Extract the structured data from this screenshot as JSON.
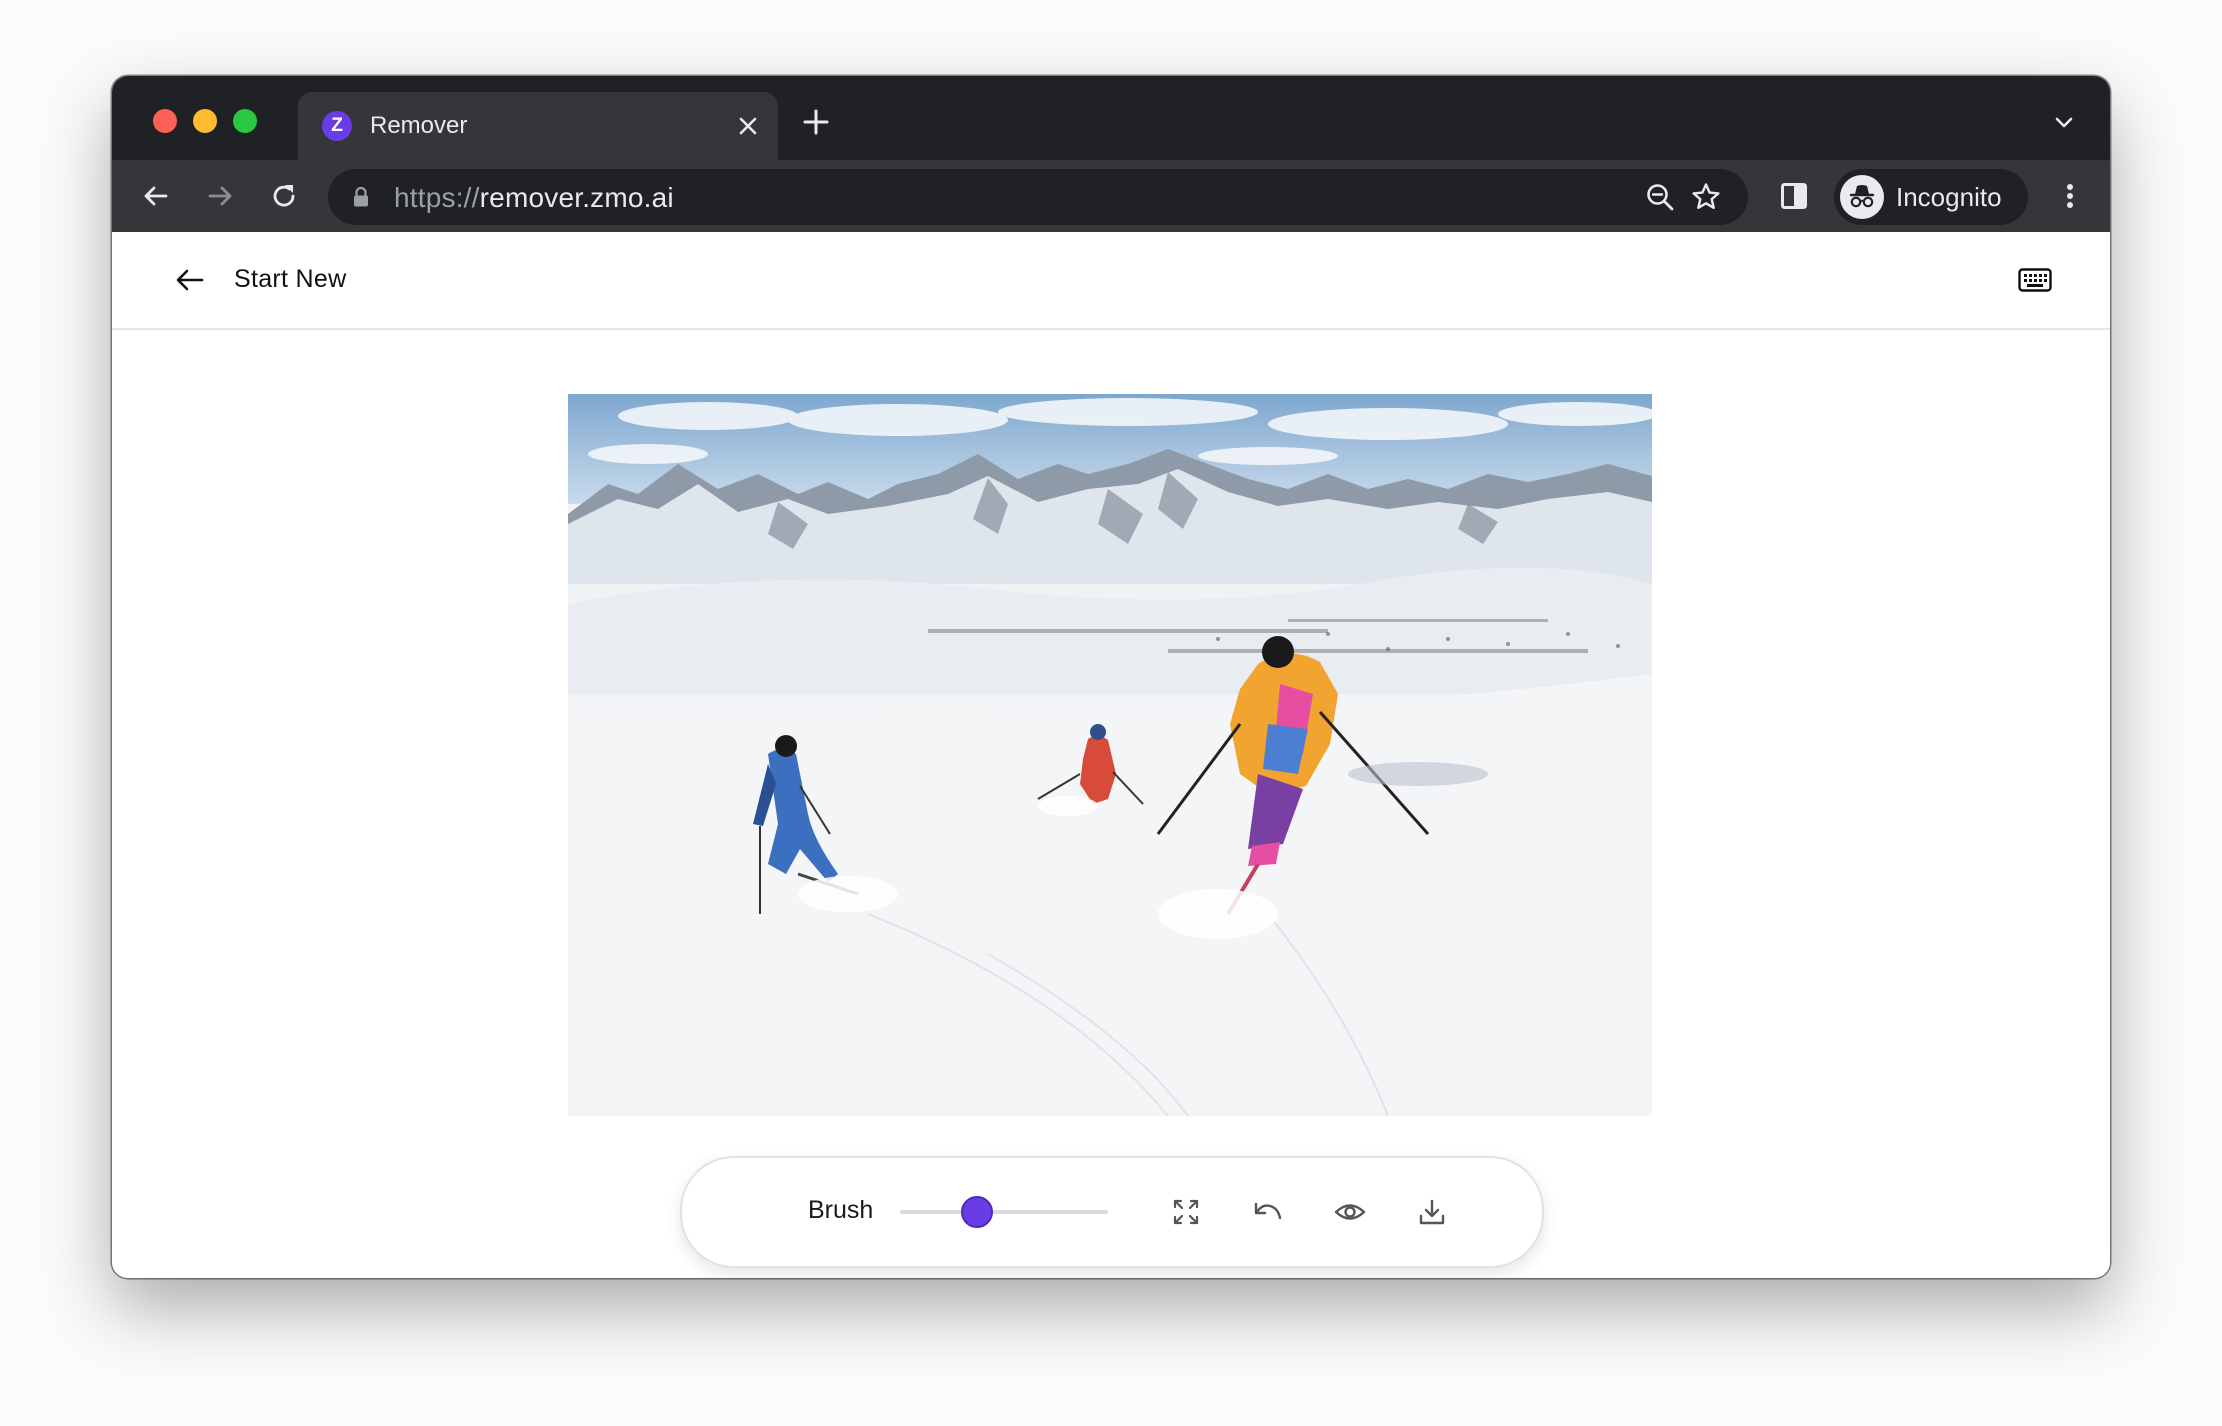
{
  "browser": {
    "tab": {
      "title": "Remover",
      "favicon_letter": "Z"
    },
    "address_bar": {
      "scheme": "https://",
      "host": "remover.zmo.ai"
    },
    "profile": {
      "label": "Incognito"
    }
  },
  "icons": {
    "window_controls": [
      "close-light-icon",
      "minimize-light-icon",
      "zoom-light-icon"
    ],
    "tab": [
      "zmo-favicon",
      "tab-close-icon",
      "new-tab-icon",
      "tab-search-icon"
    ],
    "toolbar": [
      "back-icon",
      "forward-icon",
      "reload-icon",
      "lock-icon",
      "zoom-icon",
      "bookmark-star-icon",
      "side-panel-icon",
      "incognito-icon",
      "more-menu-icon"
    ],
    "app": [
      "back-arrow-icon",
      "keyboard-icon",
      "fullscreen-icon",
      "undo-icon",
      "eye-icon",
      "download-icon"
    ]
  },
  "app": {
    "header": {
      "start_new_label": "Start New"
    },
    "canvas": {
      "image_alt": "Three skiers descending a snowy slope with mountains behind"
    },
    "toolbar": {
      "brush_label": "Brush",
      "brush_size_fraction": 0.37
    }
  },
  "colors": {
    "accent": "#6a3ce6",
    "tab_strip": "#202124",
    "toolbar": "#35363a",
    "traffic_red": "#fe5f57",
    "traffic_yellow": "#febc2e",
    "traffic_green": "#28c840"
  }
}
